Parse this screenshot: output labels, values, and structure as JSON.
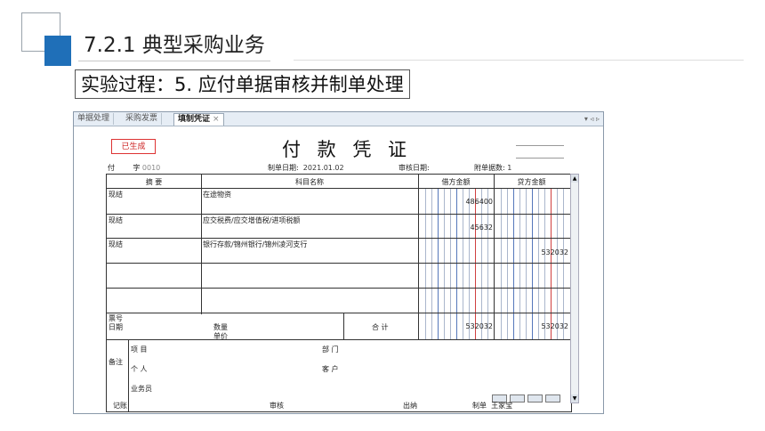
{
  "slide": {
    "section_title": "7.2.1  典型采购业务",
    "subtitle": "实验过程：5. 应付单据审核并制单处理"
  },
  "window": {
    "tabs": [
      {
        "label": "单据处理"
      },
      {
        "label": "采购发票"
      },
      {
        "label": "填制凭证",
        "active": true
      }
    ],
    "close_glyph": "×",
    "nav_glyphs": "▾ ◃ ▹"
  },
  "voucher": {
    "status_stamp": "已生成",
    "title": "付 款 凭 证",
    "type_prefix": "付",
    "number_label": "字",
    "number": "0010",
    "date_label": "制单日期:",
    "date": "2021.01.02",
    "audit_date_label": "审核日期:",
    "attachments_label": "附单据数:",
    "attachments": "1",
    "headers": {
      "summary": "摘 要",
      "account": "科目名称",
      "debit": "借方金额",
      "credit": "贷方金额"
    },
    "rows": [
      {
        "summary": "现结",
        "account": "在途物资",
        "debit": "486400",
        "credit": ""
      },
      {
        "summary": "现结",
        "account": "应交税费/应交增值税/进项税额",
        "debit": "45632",
        "credit": ""
      },
      {
        "summary": "现结",
        "account": "银行存款/锦州银行/锦州凌河支行",
        "debit": "",
        "credit": "532032"
      },
      {
        "summary": "",
        "account": "",
        "debit": "",
        "credit": ""
      },
      {
        "summary": "",
        "account": "",
        "debit": "",
        "credit": ""
      }
    ],
    "footer": {
      "ticket_no_label": "票号",
      "date_label": "日期",
      "qty_label": "数量",
      "price_label": "单价",
      "total_label": "合 计",
      "total_debit": "532032",
      "total_credit": "532032"
    },
    "remarks": {
      "label": "备注",
      "project_label": "项  目",
      "dept_label": "部  门",
      "person_label": "个  人",
      "customer_label": "客  户",
      "salesman_label": "业务员"
    },
    "signatures": {
      "bookkeeping_label": "记账",
      "audit_label": "审核",
      "cashier_label": "出纳",
      "preparer_label": "制单",
      "preparer": "王家宝"
    }
  },
  "colors": {
    "accent": "#1f6fb8",
    "stamp": "#cc2222",
    "digit_line_red": "#d04040",
    "digit_line_blue": "#5577bb"
  }
}
